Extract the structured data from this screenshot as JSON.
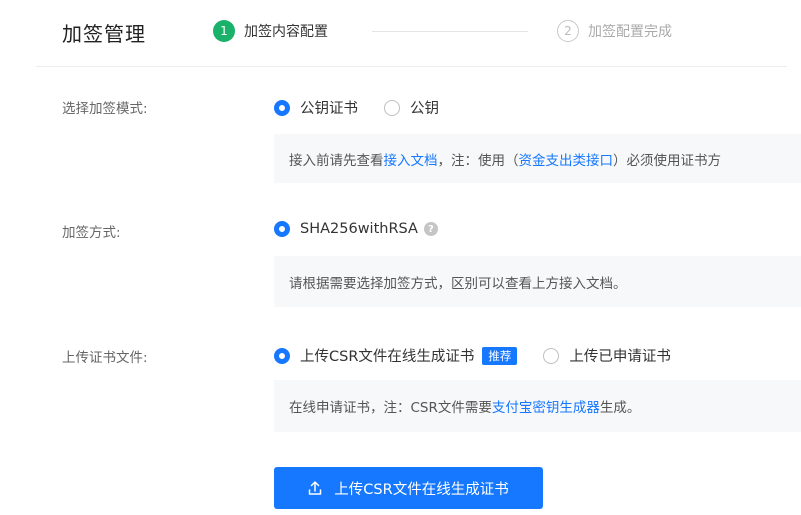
{
  "header": {
    "title": "加签管理",
    "steps": [
      {
        "num": "1",
        "label": "加签内容配置"
      },
      {
        "num": "2",
        "label": "加签配置完成"
      }
    ]
  },
  "mode": {
    "label": "选择加签模式:",
    "options": [
      "公钥证书",
      "公钥"
    ],
    "info": {
      "prefix": "接入前请先查看",
      "link1": "接入文档",
      "middle": "，注：使用（",
      "link2": "资金支出类接口",
      "suffix": "）必须使用证书方"
    }
  },
  "method": {
    "label": "加签方式:",
    "option": "SHA256withRSA",
    "help_icon": "question-icon",
    "info": "请根据需要选择加签方式，区别可以查看上方接入文档。"
  },
  "upload": {
    "label": "上传证书文件:",
    "options": [
      "上传CSR文件在线生成证书",
      "上传已申请证书"
    ],
    "badge": "推荐",
    "info": {
      "prefix": "在线申请证书，注：CSR文件需要",
      "link": "支付宝密钥生成器",
      "suffix": "生成。"
    },
    "button": "上传CSR文件在线生成证书",
    "button_icon": "upload-icon"
  },
  "colors": {
    "accent": "#1677ff",
    "step_active": "#1ab26b"
  }
}
